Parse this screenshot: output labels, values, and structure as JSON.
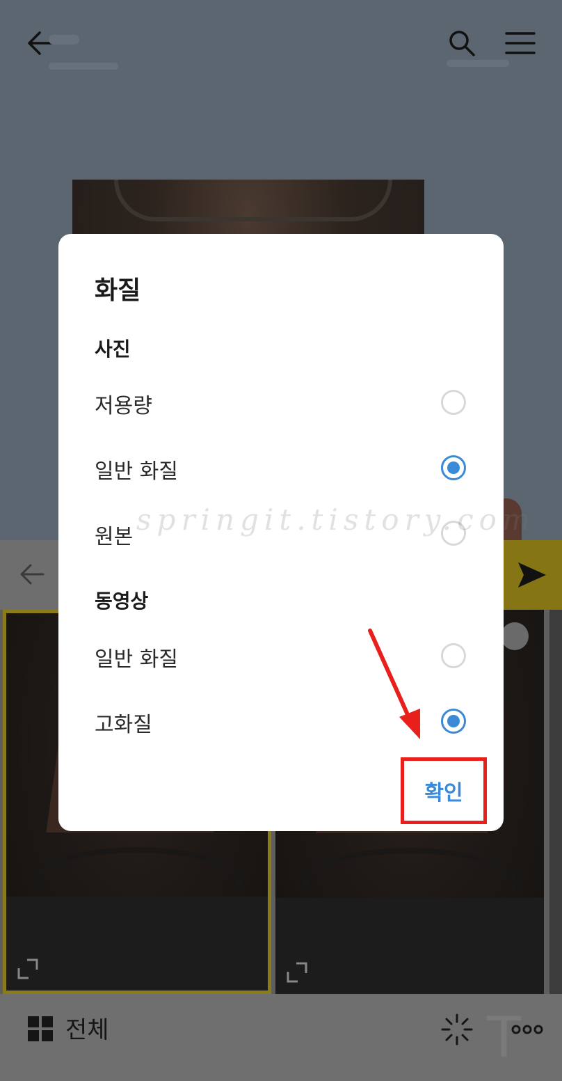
{
  "dialog": {
    "title": "화질",
    "photo_section": "사진",
    "photo_options": [
      {
        "label": "저용량",
        "selected": false
      },
      {
        "label": "일반 화질",
        "selected": true
      },
      {
        "label": "원본",
        "selected": false
      }
    ],
    "video_section": "동영상",
    "video_options": [
      {
        "label": "일반 화질",
        "selected": false
      },
      {
        "label": "고화질",
        "selected": true
      }
    ],
    "confirm_label": "확인"
  },
  "bottom_bar": {
    "all_label": "전체"
  },
  "watermark": "springit.tistory.com",
  "colors": {
    "accent": "#3a8ad8",
    "annotation": "#e8201c",
    "send_yellow": "#857514"
  }
}
